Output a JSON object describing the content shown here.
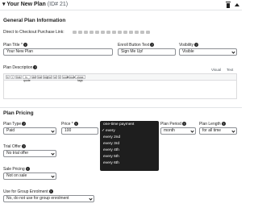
{
  "header": {
    "caret": "▾",
    "title": "Your New Plan",
    "id": "(ID# 21)",
    "icons": [
      "trash-icon",
      "caret-up-icon"
    ]
  },
  "general": {
    "heading": "General Plan Information",
    "checkout_label": "Direct to Checkout Purchase Link:",
    "plan_title_label": "Plan Title *",
    "plan_title_value": "Your New Plan",
    "enroll_label": "Enroll Button Text",
    "enroll_value": "Sign Me Up!",
    "visibility_label": "Visibility",
    "visibility_value": "Visible",
    "description_label": "Plan Description",
    "editor_tabs": [
      "Visual",
      "Text"
    ],
    "toolbar": [
      "b",
      "i",
      "link",
      "b-quote",
      "del",
      "ins",
      "img",
      "ul",
      "ol",
      "li",
      "code",
      "more",
      "close tags"
    ]
  },
  "pricing": {
    "heading": "Plan Pricing",
    "type_label": "Plan Type",
    "type_value": "Paid",
    "price_label": "Price *",
    "price_value": "100",
    "period_label": "Plan Period",
    "period_value": "month",
    "length_label": "Plan Length",
    "length_value": "for all time",
    "interval_menu": [
      "one-time payment",
      "every",
      "every 2nd",
      "every 3rd",
      "every 4th",
      "every 5th",
      "every 6th"
    ],
    "interval_selected": "every",
    "trial_label": "Trial Offer",
    "trial_value": "No trial offer",
    "sale_label": "Sale Pricing",
    "sale_value": "Not on sale",
    "group_label": "Use for Group Enrolment",
    "group_value": "No, do not use for group enrolment"
  }
}
